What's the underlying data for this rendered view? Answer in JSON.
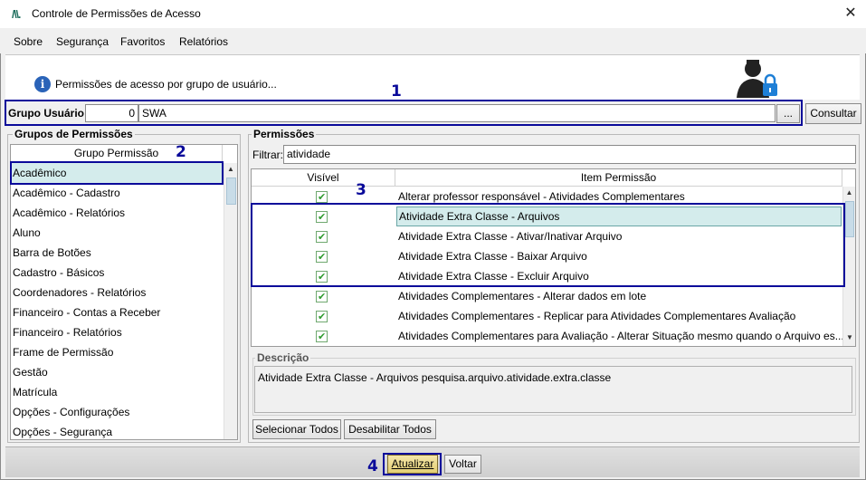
{
  "window": {
    "title": "Controle de Permissões de Acesso",
    "logo": "/\\\\.",
    "close": "✕"
  },
  "menu": {
    "items": [
      "Sobre",
      "Segurança",
      "Favoritos",
      "Relatórios"
    ]
  },
  "header": {
    "info_text": "Permissões de acesso por grupo de usuário...",
    "info_icon": "i"
  },
  "grupo_usuario": {
    "label": "Grupo Usuário:",
    "code": "0",
    "name": "SWA",
    "browse_label": "...",
    "consultar_label": "Consultar"
  },
  "grupos_permissoes": {
    "title": "Grupos de Permissões",
    "column_header": "Grupo Permissão",
    "items": [
      "Acadêmico",
      "Acadêmico - Cadastro",
      "Acadêmico - Relatórios",
      "Aluno",
      "Barra de Botões",
      "Cadastro - Básicos",
      "Coordenadores - Relatórios",
      "Financeiro - Contas a Receber",
      "Financeiro - Relatórios",
      "Frame de Permissão",
      "Gestão",
      "Matrícula",
      "Opções - Configurações",
      "Opções - Segurança"
    ],
    "selected_index": 0
  },
  "permissoes": {
    "title": "Permissões",
    "filter_label": "Filtrar:",
    "filter_value": "atividade",
    "columns": [
      "Visível",
      "Item Permissão"
    ],
    "rows": [
      {
        "visible": true,
        "item": "Alterar professor responsável - Atividades Complementares"
      },
      {
        "visible": true,
        "item": "Atividade Extra Classe - Arquivos"
      },
      {
        "visible": true,
        "item": "Atividade Extra Classe - Ativar/Inativar Arquivo"
      },
      {
        "visible": true,
        "item": "Atividade Extra Classe - Baixar Arquivo"
      },
      {
        "visible": true,
        "item": "Atividade Extra Classe - Excluir Arquivo"
      },
      {
        "visible": true,
        "item": "Atividades Complementares - Alterar dados em lote"
      },
      {
        "visible": true,
        "item": "Atividades Complementares - Replicar para Atividades Complementares Avaliação"
      },
      {
        "visible": true,
        "item": "Atividades Complementares para Avaliação - Alterar Situação mesmo quando o Arquivo es..."
      }
    ],
    "selected_index": 1,
    "descricao_title": "Descrição",
    "descricao_text": "Atividade Extra Classe - Arquivos pesquisa.arquivo.atividade.extra.classe",
    "select_all_label": "Selecionar Todos",
    "disable_all_label": "Desabilitar Todos"
  },
  "footer": {
    "atualizar_label": "Atualizar",
    "voltar_label": "Voltar"
  },
  "annotations": [
    "1",
    "2",
    "3",
    "4"
  ],
  "colors": {
    "annotation": "#0a0a9a",
    "selection": "#d4ecec",
    "check": "#2e9b2e",
    "info_icon": "#2a63b8"
  }
}
